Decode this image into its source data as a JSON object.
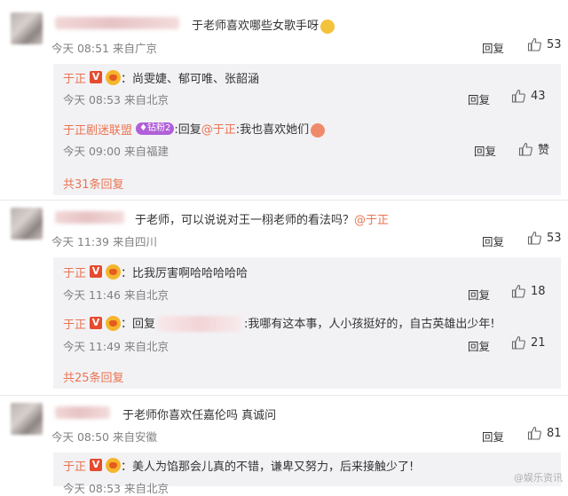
{
  "comments": [
    {
      "text": "于老师喜欢哪些女歌手呀",
      "emoji": "doge-emoji",
      "meta": "今天 08:51 来自广京",
      "reply_label": "回复",
      "likes": "53",
      "replies": [
        {
          "user": "于正",
          "verified": "V",
          "text": "尚雯婕、郁可唯、张韶涵",
          "meta": "今天 08:53 来自北京",
          "reply_label": "回复",
          "likes": "43"
        },
        {
          "user": "于正剧迷联盟",
          "badge": "钻粉2",
          "prefix": "回复",
          "mention": "@于正",
          "text": ":我也喜欢她们",
          "meta": "今天 09:00 来自福建",
          "reply_label": "回复",
          "likes": "赞"
        }
      ],
      "total": "共31条回复"
    },
    {
      "text": "于老师，可以说说对王一栩老师的看法吗？",
      "mention": "@于正",
      "meta": "今天 11:39 来自四川",
      "reply_label": "回复",
      "likes": "53",
      "replies": [
        {
          "user": "于正",
          "verified": "V",
          "text": "比我厉害啊哈哈哈哈哈",
          "meta": "今天 11:46 来自北京",
          "reply_label": "回复",
          "likes": "18"
        },
        {
          "user": "于正",
          "verified": "V",
          "prefix": "回复",
          "text": ":我哪有这本事，人小孩挺好的，自古英雄出少年!",
          "meta": "今天 11:49 来自北京",
          "reply_label": "回复",
          "likes": "21"
        }
      ],
      "total": "共25条回复"
    },
    {
      "text": "于老师你喜欢任嘉伦吗 真诚问",
      "meta": "今天 08:50 来自安徽",
      "reply_label": "回复",
      "likes": "81",
      "replies": [
        {
          "user": "于正",
          "verified": "V",
          "text": "美人为馅那会儿真的不错，谦卑又努力，后来接触少了!",
          "meta": "今天 08:53 来自北京"
        }
      ]
    }
  ],
  "watermark": "@娱乐资讯",
  "colors": {
    "username": "#eb7350",
    "link": "#eb7350",
    "meta": "#808080",
    "reply_bg": "#f2f2f5",
    "verified_badge": "#e64b2e",
    "diamond_badge": "#b05fd9"
  }
}
